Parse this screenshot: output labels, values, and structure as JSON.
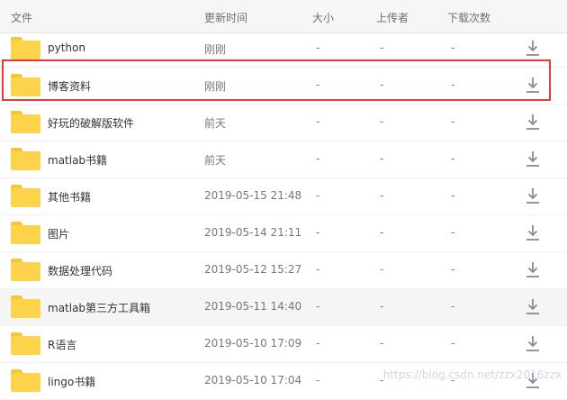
{
  "header": {
    "name": "文件",
    "time": "更新时间",
    "size": "大小",
    "uploader": "上传者",
    "downloads": "下载次数"
  },
  "rows": [
    {
      "name": "python",
      "time": "刚刚",
      "size": "-",
      "uploader": "-",
      "downloads": "-"
    },
    {
      "name": "博客资料",
      "time": "刚刚",
      "size": "-",
      "uploader": "-",
      "downloads": "-"
    },
    {
      "name": "好玩的破解版软件",
      "time": "前天",
      "size": "-",
      "uploader": "-",
      "downloads": "-"
    },
    {
      "name": "matlab书籍",
      "time": "前天",
      "size": "-",
      "uploader": "-",
      "downloads": "-"
    },
    {
      "name": "其他书籍",
      "time": "2019-05-15 21:48",
      "size": "-",
      "uploader": "-",
      "downloads": "-"
    },
    {
      "name": "图片",
      "time": "2019-05-14 21:11",
      "size": "-",
      "uploader": "-",
      "downloads": "-"
    },
    {
      "name": "数据处理代码",
      "time": "2019-05-12 15:27",
      "size": "-",
      "uploader": "-",
      "downloads": "-"
    },
    {
      "name": "matlab第三方工具箱",
      "time": "2019-05-11 14:40",
      "size": "-",
      "uploader": "-",
      "downloads": "-"
    },
    {
      "name": "R语言",
      "time": "2019-05-10 17:09",
      "size": "-",
      "uploader": "-",
      "downloads": "-"
    },
    {
      "name": "lingo书籍",
      "time": "2019-05-10 17:04",
      "size": "-",
      "uploader": "-",
      "downloads": "-"
    }
  ],
  "watermark": "https://blog.csdn.net/zzx2016zzx",
  "icons": {
    "folder": "folder-icon",
    "download": "download-icon"
  },
  "colors": {
    "highlight": "#e5393a",
    "folder": "#fcd34b"
  }
}
